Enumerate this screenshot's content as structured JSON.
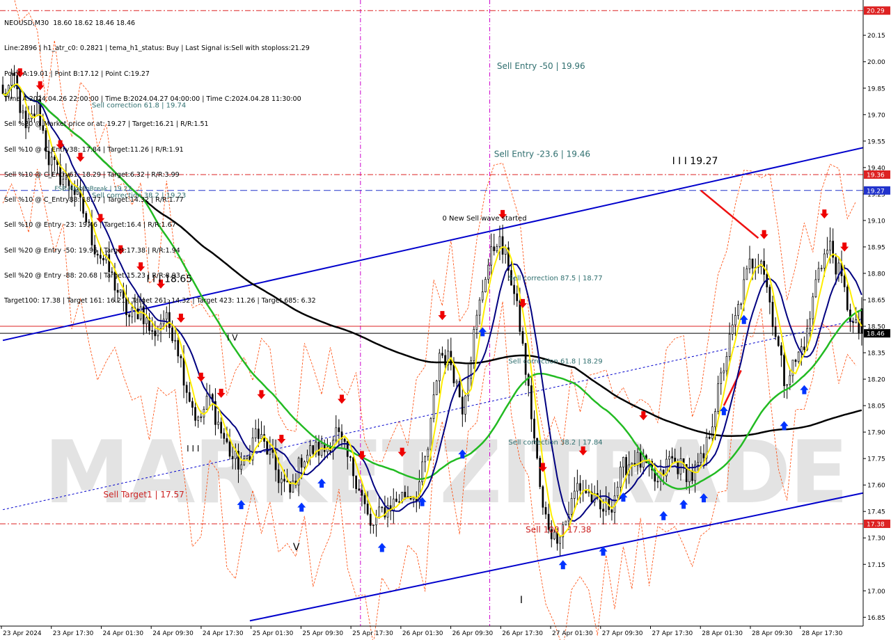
{
  "info_panel": {
    "lines": [
      "NEOUSD,M30  18.60 18.62 18.46 18.46",
      "Line:2896 | h1_atr_c0: 0.2821 | tema_h1_status: Buy | Last Signal is:Sell with stoploss:21.29",
      "Point A:19.01 | Point B:17.12 | Point C:19.27",
      "Time A:2024.04.26 22:00:00 | Time B:2024.04.27 04:00:00 | Time C:2024.04.28 11:30:00",
      "Sell %20 @ Market price or at: 19.27 | Target:16.21 | R/R:1.51",
      "Sell %10 @ C_Entry38: 17.84 | Target:11.26 | R/R:1.91",
      "Sell %10 @ C_Entry61: 18.29 | Target:6.32 | R/R:3.99",
      "Sell %10 @ C_Entry88: 18.77 | Target:14.32 | R/R:1.77",
      "Sell %10 @ Entry -23: 19.46 | Target:16.4 | R/R:1.67",
      "Sell %20 @ Entry -50: 19.96 | Target:17.38 | R/R:1.94",
      "Sell %20 @ Entry -88: 20.68 | Target:15.23 | R/R:8.93",
      "Target100: 17.38 | Target 161: 16.21 | Target 261: 14.32 | Target 423: 11.26 | Target 685: 6.32"
    ]
  },
  "colors": {
    "background": "#ffffff",
    "candle": "#000000",
    "channel": "#0000cc",
    "ma_black": "#000000",
    "ma_green": "#22bb22",
    "ma_navy": "#000080",
    "ma_yellow": "#ffee00",
    "envelope": "#ff4400",
    "level_red": "#cc0000",
    "level_blue": "#0000cc",
    "vline": "#cc00cc",
    "up_arrow": "#0033ff",
    "down_arrow": "#ee0000",
    "price_tag_red": "#dd2222",
    "price_tag_blue": "#2233cc",
    "price_tag_black": "#000000"
  },
  "watermark": "MARKETZITRADE",
  "chart_data": {
    "type": "candlestick",
    "symbol": "NEOUSD",
    "timeframe": "M30",
    "ylim": [
      16.8,
      20.35
    ],
    "y_ticks": [
      "20.15",
      "20.00",
      "19.85",
      "19.70",
      "19.55",
      "19.40",
      "19.25",
      "19.10",
      "18.95",
      "18.80",
      "18.65",
      "18.50",
      "18.35",
      "18.20",
      "18.05",
      "17.90",
      "17.75",
      "17.60",
      "17.45",
      "17.30",
      "17.15",
      "17.00",
      "16.85"
    ],
    "x_labels": [
      "23 Apr 2024",
      "23 Apr 17:30",
      "24 Apr 01:30",
      "24 Apr 09:30",
      "24 Apr 17:30",
      "25 Apr 01:30",
      "25 Apr 09:30",
      "25 Apr 17:30",
      "26 Apr 01:30",
      "26 Apr 09:30",
      "26 Apr 17:30",
      "27 Apr 01:30",
      "27 Apr 09:30",
      "27 Apr 17:30",
      "28 Apr 01:30",
      "28 Apr 09:30",
      "28 Apr 17:30"
    ],
    "close_path": [
      [
        0,
        19.8
      ],
      [
        4,
        19.9
      ],
      [
        8,
        19.6
      ],
      [
        12,
        19.75
      ],
      [
        16,
        19.45
      ],
      [
        20,
        19.35
      ],
      [
        24,
        19.3
      ],
      [
        28,
        19.15
      ],
      [
        32,
        18.95
      ],
      [
        36,
        18.85
      ],
      [
        40,
        18.7
      ],
      [
        44,
        18.55
      ],
      [
        48,
        18.6
      ],
      [
        52,
        18.45
      ],
      [
        56,
        18.55
      ],
      [
        60,
        18.45
      ],
      [
        64,
        18.15
      ],
      [
        68,
        17.95
      ],
      [
        72,
        18.1
      ],
      [
        76,
        17.9
      ],
      [
        80,
        17.75
      ],
      [
        84,
        17.7
      ],
      [
        88,
        17.9
      ],
      [
        92,
        17.8
      ],
      [
        96,
        17.65
      ],
      [
        100,
        17.55
      ],
      [
        104,
        17.75
      ],
      [
        108,
        17.8
      ],
      [
        112,
        17.8
      ],
      [
        116,
        17.9
      ],
      [
        120,
        17.75
      ],
      [
        124,
        17.6
      ],
      [
        128,
        17.35
      ],
      [
        132,
        17.45
      ],
      [
        136,
        17.5
      ],
      [
        140,
        17.55
      ],
      [
        144,
        17.55
      ],
      [
        148,
        17.8
      ],
      [
        152,
        18.35
      ],
      [
        156,
        18.3
      ],
      [
        160,
        18.05
      ],
      [
        164,
        18.45
      ],
      [
        168,
        18.8
      ],
      [
        172,
        19.0
      ],
      [
        176,
        18.85
      ],
      [
        180,
        18.5
      ],
      [
        184,
        18.0
      ],
      [
        188,
        17.45
      ],
      [
        192,
        17.3
      ],
      [
        196,
        17.4
      ],
      [
        200,
        17.6
      ],
      [
        204,
        17.55
      ],
      [
        208,
        17.45
      ],
      [
        212,
        17.5
      ],
      [
        216,
        17.7
      ],
      [
        220,
        17.75
      ],
      [
        224,
        17.7
      ],
      [
        228,
        17.6
      ],
      [
        232,
        17.75
      ],
      [
        236,
        17.7
      ],
      [
        240,
        17.65
      ],
      [
        244,
        17.75
      ],
      [
        248,
        18.05
      ],
      [
        252,
        18.35
      ],
      [
        256,
        18.6
      ],
      [
        260,
        18.85
      ],
      [
        264,
        18.9
      ],
      [
        268,
        18.55
      ],
      [
        272,
        18.2
      ],
      [
        276,
        18.3
      ],
      [
        280,
        18.45
      ],
      [
        284,
        18.85
      ],
      [
        288,
        18.95
      ],
      [
        292,
        18.75
      ],
      [
        296,
        18.5
      ],
      [
        299,
        18.46
      ]
    ],
    "n_bars": 300,
    "moving_averages": [
      {
        "color": "#000000",
        "period": 200
      },
      {
        "color": "#22bb22",
        "period": 50
      },
      {
        "color": "#000080",
        "period": 12
      },
      {
        "color": "#ffee00",
        "period": 5
      }
    ],
    "price_levels": [
      {
        "value": 20.29,
        "label": "20.29",
        "color": "#dd2222",
        "style": "dashdot"
      },
      {
        "value": 19.36,
        "label": "19.36",
        "color": "#dd2222",
        "style": "dashdot"
      },
      {
        "value": 19.27,
        "label": "19.27",
        "color": "#2233cc",
        "style": "dash"
      },
      {
        "value": 18.46,
        "label": "18.46",
        "color": "#000000",
        "style": "solid"
      },
      {
        "value": 17.38,
        "label": "17.38",
        "color": "#dd2222",
        "style": "dashdot"
      }
    ],
    "annotations": [
      {
        "text": "Sell Entry -50 | 19.96",
        "bar": 172,
        "price": 19.96,
        "color": "#2f6f6f",
        "size": 12
      },
      {
        "text": "Sell correction 61.8 | 19.74",
        "bar": 31,
        "price": 19.74,
        "color": "#2f6f6f",
        "size": 10
      },
      {
        "text": "Sell Entry -23.6 | 19.46",
        "bar": 171,
        "price": 19.46,
        "color": "#2f6f6f",
        "size": 12
      },
      {
        "text": "I I I 19.27",
        "bar": 233,
        "price": 19.42,
        "color": "#000000",
        "size": 14
      },
      {
        "text": "FSB-HighToBreak | 19.27",
        "bar": 18,
        "price": 19.27,
        "color": "#2f6f6f",
        "size": 9
      },
      {
        "text": "Sell correction 38.2 | 19.23",
        "bar": 31,
        "price": 19.23,
        "color": "#2f6f6f",
        "size": 10
      },
      {
        "text": "0 New Sell wave started",
        "bar": 153,
        "price": 19.1,
        "color": "#000000",
        "size": 10
      },
      {
        "text": "I I I 18.65",
        "bar": 50,
        "price": 18.75,
        "color": "#000000",
        "size": 14
      },
      {
        "text": "Sell correction 87.5 | 18.77",
        "bar": 176,
        "price": 18.76,
        "color": "#2f6f6f",
        "size": 10
      },
      {
        "text": "Sell correction 61.8 | 18.29",
        "bar": 176,
        "price": 18.29,
        "color": "#2f6f6f",
        "size": 10
      },
      {
        "text": "Sell correction 38.2 | 17.84",
        "bar": 176,
        "price": 17.83,
        "color": "#2f6f6f",
        "size": 10
      },
      {
        "text": "Sell Target1 | 17.57",
        "bar": 35,
        "price": 17.53,
        "color": "#cc2222",
        "size": 12
      },
      {
        "text": "Sell 100 | 17.38",
        "bar": 182,
        "price": 17.33,
        "color": "#cc2222",
        "size": 12
      },
      {
        "text": "I I I",
        "bar": 64,
        "price": 17.79,
        "color": "#000000",
        "size": 12
      },
      {
        "text": "I V",
        "bar": 78,
        "price": 18.42,
        "color": "#000000",
        "size": 12
      },
      {
        "text": "V",
        "bar": 101,
        "price": 17.23,
        "color": "#000000",
        "size": 14
      },
      {
        "text": "I",
        "bar": 180,
        "price": 16.93,
        "color": "#000000",
        "size": 14
      }
    ],
    "vertical_lines": [
      {
        "bar": 124.5,
        "color": "#cc00cc"
      },
      {
        "bar": 169.5,
        "color": "#cc00cc"
      }
    ],
    "channel_upper": {
      "p1": [
        0,
        18.42
      ],
      "p2": [
        307,
        19.54
      ]
    },
    "channel_lower": {
      "p1": [
        86,
        16.83
      ],
      "p2": [
        307,
        17.58
      ]
    },
    "channel_mid": {
      "p1": [
        0,
        17.46
      ],
      "p2": [
        307,
        18.57
      ]
    },
    "red_segments": [
      {
        "p1": [
          243,
          19.27
        ],
        "p2": [
          263,
          19.0
        ]
      },
      {
        "p1": [
          251,
          18.05
        ],
        "p2": [
          257,
          18.25
        ]
      }
    ]
  }
}
